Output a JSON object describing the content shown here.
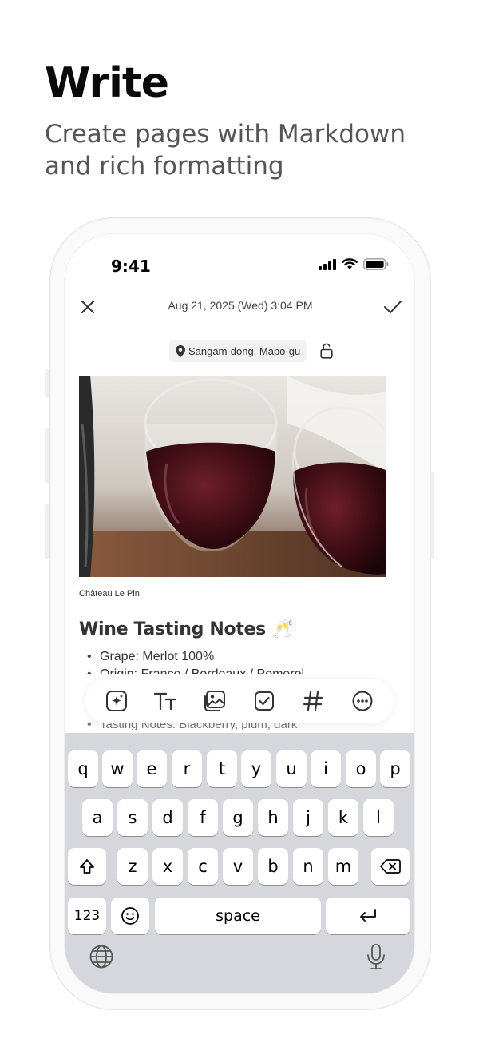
{
  "headline": "Write",
  "subheadline": "Create pages with Markdown and rich formatting",
  "status_bar": {
    "time": "9:41"
  },
  "editor": {
    "date": "Aug 21, 2025 (Wed) 3:04 PM",
    "location": "Sangam-dong, Mapo-gu",
    "photo_caption": "Château Le Pin",
    "note_title": "Wine Tasting Notes 🥂",
    "bullets": [
      "Grape: Merlot 100%",
      "Origin: France / Bordeaux / Pomerol",
      "Tasting Notes: Blackberry, plum, dark"
    ]
  },
  "toolbar": {
    "icons": [
      "sparkle-icon",
      "text-size-icon",
      "image-icon",
      "checkbox-icon",
      "hashtag-icon",
      "more-icon"
    ]
  },
  "keyboard": {
    "row1": [
      "q",
      "w",
      "e",
      "r",
      "t",
      "y",
      "u",
      "i",
      "o",
      "p"
    ],
    "row2": [
      "a",
      "s",
      "d",
      "f",
      "g",
      "h",
      "j",
      "k",
      "l"
    ],
    "row3": [
      "z",
      "x",
      "c",
      "v",
      "b",
      "n",
      "m"
    ],
    "numbers_label": "123",
    "space_label": "space"
  }
}
